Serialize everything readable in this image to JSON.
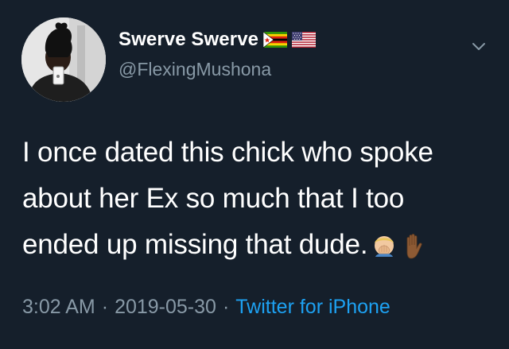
{
  "author": {
    "display_name": "Swerve Swerve",
    "handle": "@FlexingMushona",
    "flags": [
      "zimbabwe-flag-icon",
      "us-flag-icon"
    ]
  },
  "tweet": {
    "lines": [
      "I once dated this chick who spoke",
      "about her Ex so much that I too",
      "ended up missing that dude."
    ],
    "emojis": [
      "face-palm-emoji",
      "raised-hand-emoji"
    ]
  },
  "meta": {
    "time": "3:02 AM",
    "date": "2019-05-30",
    "separator": "·",
    "source": "Twitter for iPhone"
  },
  "colors": {
    "background": "#151f2b",
    "text": "#ffffff",
    "secondary": "#8899a6",
    "link": "#1da1f2"
  }
}
